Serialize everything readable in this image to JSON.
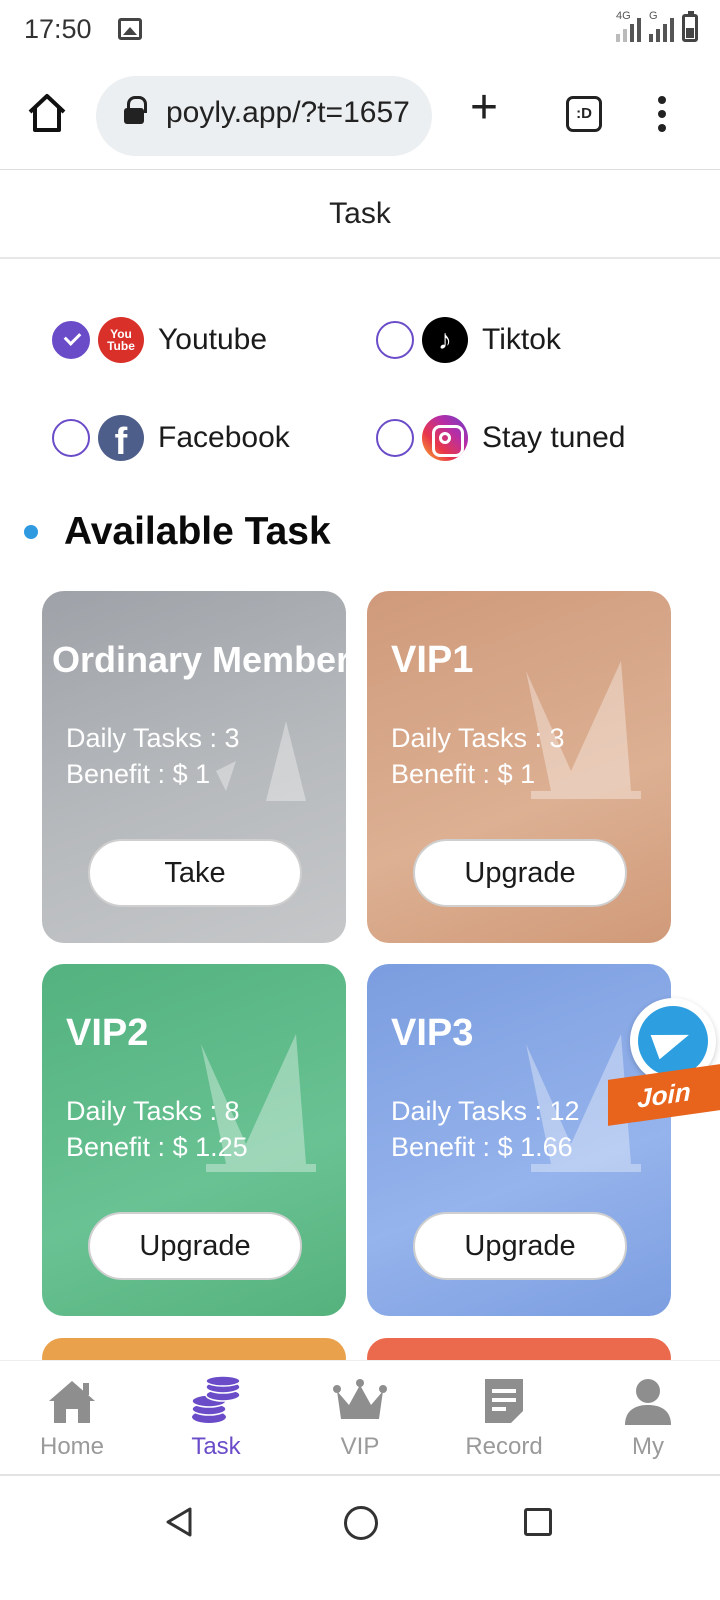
{
  "status_bar": {
    "time": "17:50",
    "network_1": "4G",
    "network_2": "G"
  },
  "browser": {
    "url": "poyly.app/?t=1657",
    "tab_icon_text": ":D"
  },
  "page": {
    "title": "Task"
  },
  "platforms": [
    {
      "label": "Youtube",
      "icon": "youtube-icon",
      "checked": true
    },
    {
      "label": "Tiktok",
      "icon": "tiktok-icon",
      "checked": false
    },
    {
      "label": "Facebook",
      "icon": "facebook-icon",
      "checked": false
    },
    {
      "label": "Stay tuned",
      "icon": "instagram-icon",
      "checked": false
    }
  ],
  "youtube_logo_text": "You Tube",
  "section": {
    "title": "Available Task"
  },
  "cards": [
    {
      "title": "Ordinary Member",
      "daily_tasks": "Daily Tasks : 3",
      "benefit": "Benefit : $ 1",
      "button": "Take"
    },
    {
      "title": "VIP1",
      "daily_tasks": "Daily Tasks : 3",
      "benefit": "Benefit : $ 1",
      "button": "Upgrade"
    },
    {
      "title": "VIP2",
      "daily_tasks": "Daily Tasks : 8",
      "benefit": "Benefit : $ 1.25",
      "button": "Upgrade"
    },
    {
      "title": "VIP3",
      "daily_tasks": "Daily Tasks : 12",
      "benefit": "Benefit : $ 1.66",
      "button": "Upgrade"
    }
  ],
  "telegram": {
    "join_label": "Join"
  },
  "bottom_nav": [
    {
      "label": "Home",
      "icon": "home-icon",
      "active": false
    },
    {
      "label": "Task",
      "icon": "coins-icon",
      "active": true
    },
    {
      "label": "VIP",
      "icon": "crown-icon",
      "active": false
    },
    {
      "label": "Record",
      "icon": "record-icon",
      "active": false
    },
    {
      "label": "My",
      "icon": "user-icon",
      "active": false
    }
  ],
  "colors": {
    "accent": "#6a4cc9",
    "section_dot": "#2f9ae0",
    "ordinary": "#b0b3b7",
    "vip1": "#d6a486",
    "vip2": "#5cb886",
    "vip3": "#88a8e6"
  }
}
